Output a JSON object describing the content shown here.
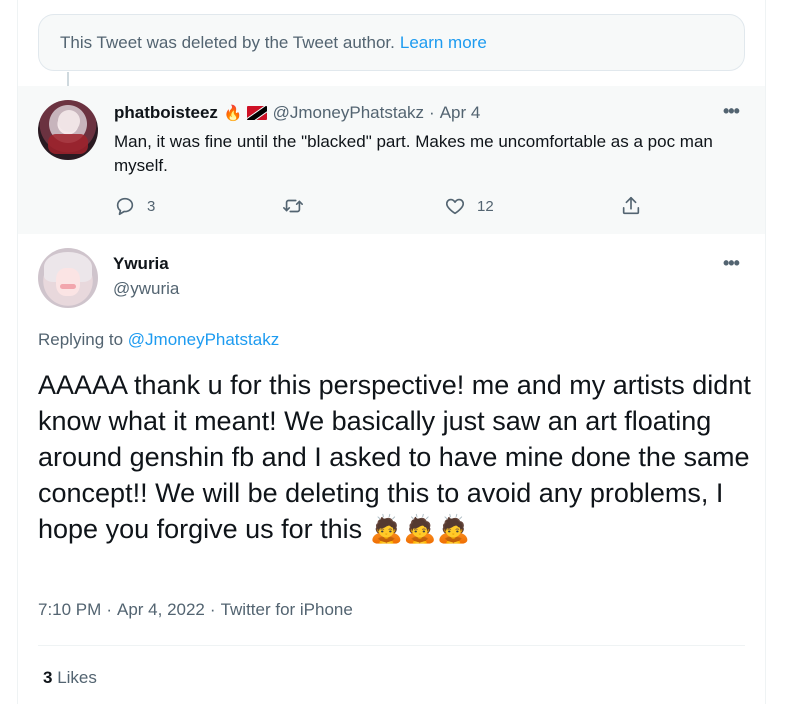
{
  "deleted_notice": {
    "text": "This Tweet was deleted by the Tweet author.",
    "link": "Learn more"
  },
  "parent_tweet": {
    "name": "phatboisteez",
    "emoji": "🔥",
    "flag_icon": "trinidad-tobago-flag-icon",
    "handle": "@JmoneyPhatstakz",
    "dot": "·",
    "time": "Apr 4",
    "more": "•••",
    "text": "Man, it was fine until the \"blacked\" part. Makes me uncomfortable as a poc man myself.",
    "actions": {
      "reply_count": "3",
      "retweet_count": "",
      "like_count": "12"
    }
  },
  "main_tweet": {
    "name": "Ywuria",
    "handle": "@ywuria",
    "more": "•••",
    "replying_prefix": "Replying to ",
    "replying_handle": "@JmoneyPhatstakz",
    "text": "AAAAA thank u for this perspective! me and my artists didnt know what it meant! We basically just saw an art floating around genshin fb and I asked to have mine done the same concept!! We will be deleting this to avoid any problems, I hope you forgive us for this 🙇🙇🙇",
    "time": "7:10 PM",
    "sep1": "·",
    "date": "Apr 4, 2022",
    "sep2": "·",
    "source": "Twitter for iPhone",
    "likes_count": "3",
    "likes_label": "Likes"
  },
  "colors": {
    "accent": "#1d9bf0",
    "secondary_text": "#536471",
    "primary_text": "#0f1419",
    "panel_bg": "#f7f9f9"
  }
}
